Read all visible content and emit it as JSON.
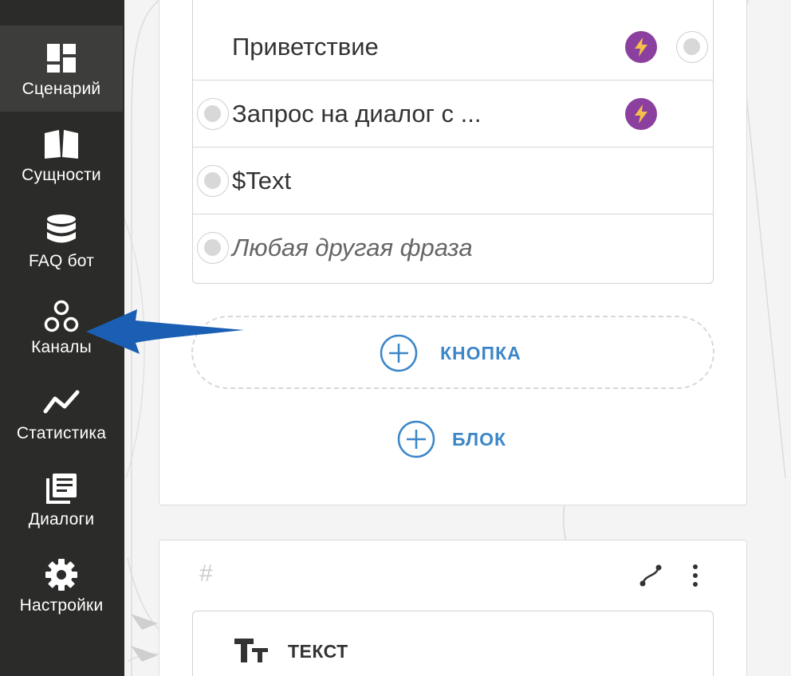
{
  "sidebar": {
    "items": [
      {
        "label": "Сценарий",
        "icon": "dashboard-icon",
        "active": true
      },
      {
        "label": "Сущности",
        "icon": "book-icon"
      },
      {
        "label": "FAQ бот",
        "icon": "database-icon"
      },
      {
        "label": "Каналы",
        "icon": "channels-icon"
      },
      {
        "label": "Статистика",
        "icon": "chart-line-icon"
      },
      {
        "label": "Диалоги",
        "icon": "dialogs-icon"
      },
      {
        "label": "Настройки",
        "icon": "gear-icon"
      }
    ]
  },
  "block": {
    "rows": [
      {
        "text": "Приветствие"
      },
      {
        "text": "Запрос на диалог с ..."
      },
      {
        "text": "$Text"
      },
      {
        "text": "Любая другая фраза"
      }
    ],
    "add_button_label": "КНОПКА",
    "add_block_label": "БЛОК"
  },
  "next_block": {
    "hash": "#",
    "text_label": "ТЕКСТ"
  },
  "colors": {
    "sidebar_bg": "#2b2b29",
    "accent_blue": "#3c86c8",
    "bolt_purple": "#8b3f9e",
    "bolt_yellow": "#f5c04a",
    "arrow_blue": "#1a5fb4"
  }
}
